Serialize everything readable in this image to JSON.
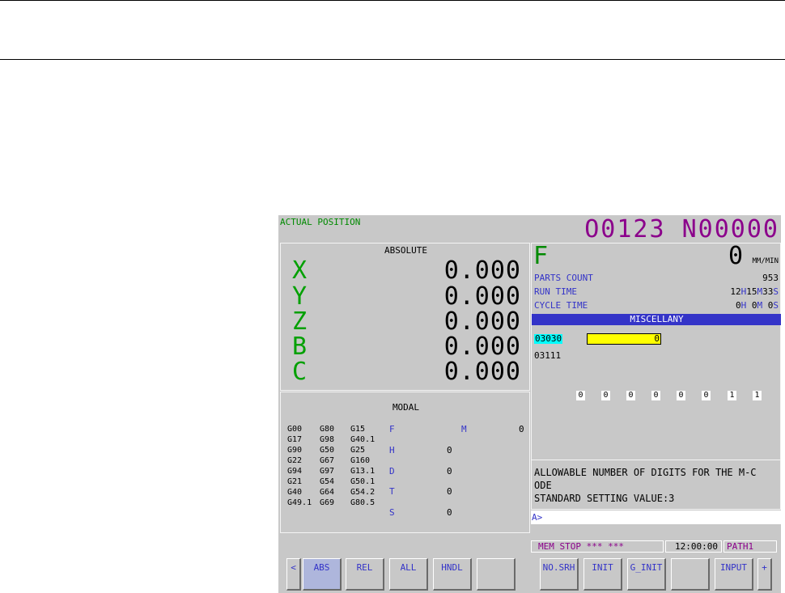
{
  "title": "ACTUAL POSITION",
  "program_number": "O0123 N00000",
  "absolute": {
    "heading": "ABSOLUTE",
    "axes": [
      {
        "name": "X",
        "value": "0.000"
      },
      {
        "name": "Y",
        "value": "0.000"
      },
      {
        "name": "Z",
        "value": "0.000"
      },
      {
        "name": "B",
        "value": "0.000"
      },
      {
        "name": "C",
        "value": "0.000"
      }
    ]
  },
  "feed": {
    "label": "F",
    "value": "0",
    "unit": "MM/MIN"
  },
  "counters": {
    "parts_count_label": "PARTS COUNT",
    "parts_count_value": "953",
    "run_time_label": "RUN TIME",
    "run_h": "12",
    "run_m": "15",
    "run_s": "33",
    "cycle_time_label": "CYCLE TIME",
    "cycle_h": "0",
    "cycle_m": "0",
    "cycle_s": "0",
    "h": "H",
    "m": "M",
    "s": "S"
  },
  "misc": {
    "heading": "MISCELLANY",
    "param1_id": "03030",
    "param1_value": "0",
    "param2_id": "03111",
    "bits": [
      "0",
      "0",
      "0",
      "0",
      "0",
      "0",
      "1",
      "1"
    ]
  },
  "description": {
    "line1": "ALLOWABLE NUMBER OF DIGITS FOR THE M-C",
    "line2": "ODE",
    "line3": "STANDARD SETTING VALUE:3"
  },
  "input_prompt": "A>",
  "modal": {
    "heading": "MODAL",
    "g_col1": [
      "G00",
      "G17",
      "G90",
      "G22",
      "G94",
      "G21",
      "G40",
      "G49.1"
    ],
    "g_col2": [
      "G80",
      "G98",
      "G50",
      "G67",
      "G97",
      "G54",
      "G64",
      "G69"
    ],
    "g_col3": [
      "G15",
      "G40.1",
      "G25",
      "G160",
      "G13.1",
      "G50.1",
      "G54.2",
      "G80.5"
    ],
    "F": "F",
    "M": "M",
    "M_value": "0",
    "H": "H",
    "H_value": "0",
    "D": "D",
    "D_value": "0",
    "T": "T",
    "T_value": "0",
    "S": "S",
    "S_value": "0"
  },
  "status": {
    "mode": "MEM",
    "state": "STOP",
    "stars": "*** ***",
    "time": "12:00:00",
    "path": "PATH1"
  },
  "softkeys": {
    "prev": "<",
    "abs": "ABS",
    "rel": "REL",
    "all": "ALL",
    "hndl": "HNDL",
    "blank1": "",
    "no_srh": "NO.SRH",
    "init": "INIT",
    "g_init": "G_INIT",
    "blank2": "",
    "input": "INPUT",
    "next": "+"
  },
  "colors": {
    "screen_bg": "#c8c8c8",
    "header_bar": "#3434c8",
    "highlight": "#ffff00",
    "param_highlight": "#00ffff"
  }
}
